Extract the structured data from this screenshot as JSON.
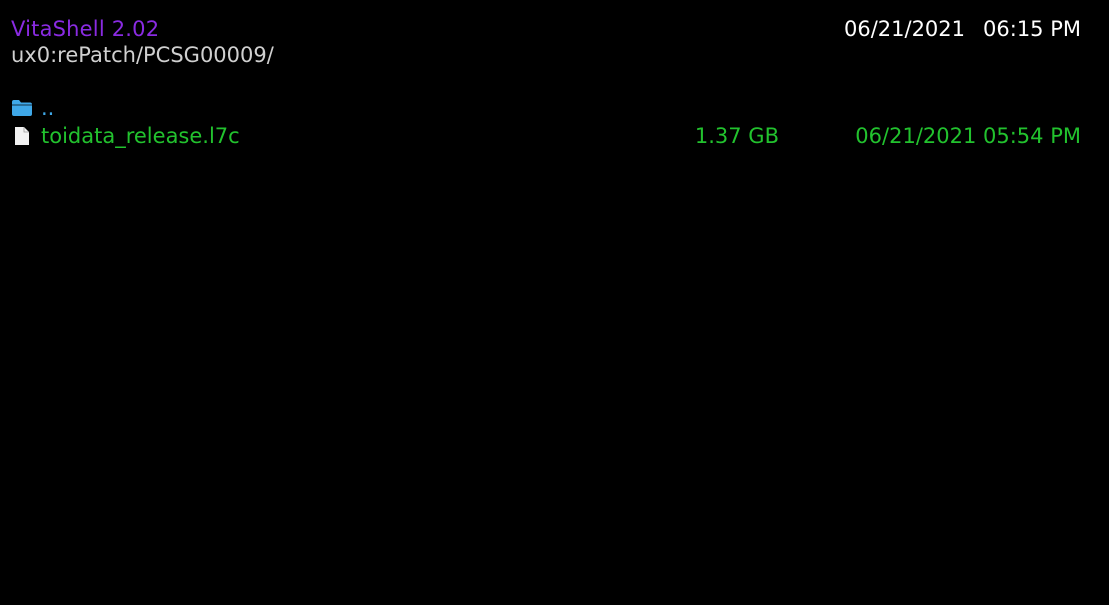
{
  "header": {
    "app_title": "VitaShell 2.02",
    "date": "06/21/2021",
    "time": "06:15 PM",
    "path": "ux0:rePatch/PCSG00009/"
  },
  "colors": {
    "title": "#8a2be2",
    "header_text": "#ffffff",
    "path_text": "#d0d0d0",
    "folder": "#3fa8e8",
    "file": "#22c22e",
    "file_icon": "#f2f2f2"
  },
  "entries": [
    {
      "icon": "folder-icon",
      "name": "..",
      "size": "",
      "date": ""
    },
    {
      "icon": "file-icon",
      "name": "toidata_release.l7c",
      "size": "1.37 GB",
      "date": "06/21/2021 05:54 PM"
    }
  ]
}
